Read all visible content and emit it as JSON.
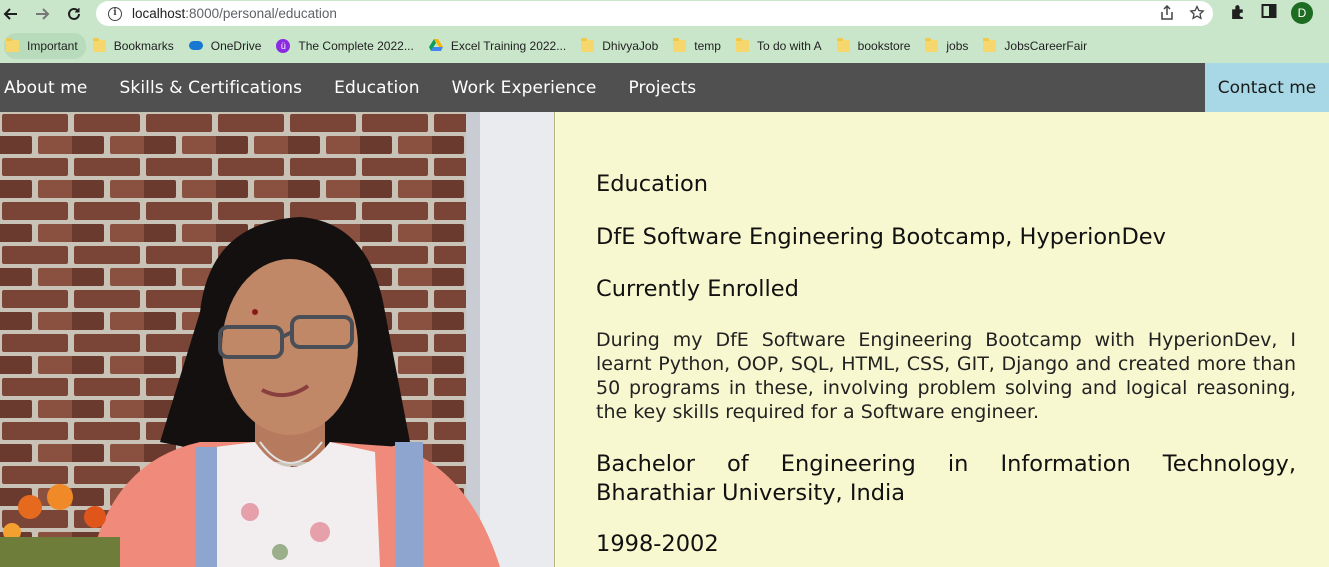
{
  "browser": {
    "url_host": "localhost",
    "url_path": ":8000/personal/education",
    "profile_initial": "D",
    "bookmarks": [
      "Important",
      "Bookmarks",
      "OneDrive",
      "The Complete 2022...",
      "Excel Training 2022...",
      "DhivyaJob",
      "temp",
      "To do with A",
      "bookstore",
      "jobs",
      "JobsCareerFair"
    ]
  },
  "nav": {
    "items": [
      "About me",
      "Skills & Certifications",
      "Education",
      "Work Experience",
      "Projects"
    ],
    "contact": "Contact me"
  },
  "main": {
    "heading": "Education",
    "entries": [
      {
        "title": "DfE Software Engineering Bootcamp, HyperionDev",
        "period": "Currently Enrolled",
        "description": "During my DfE Software Engineering Bootcamp with HyperionDev, I learnt Python, OOP, SQL, HTML, CSS, GIT, Django and created more than 50 programs in these, involving problem solving and logical reasoning, the key skills required for a Software engineer."
      },
      {
        "title": "Bachelor of Engineering in Information Technology, Bharathiar University, India",
        "period": "1998-2002"
      }
    ]
  },
  "colors": {
    "browser_frame": "#c9e6cb",
    "nav_background": "#505050",
    "contact_background": "#a8d8e6",
    "content_background": "#f8f8d0"
  }
}
